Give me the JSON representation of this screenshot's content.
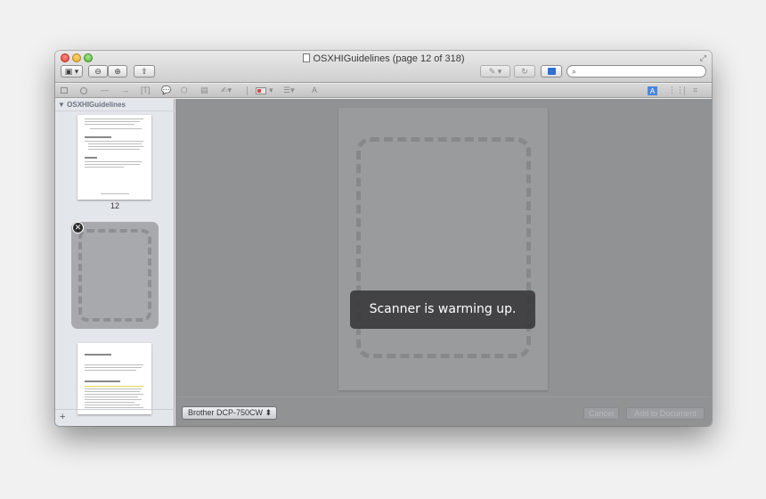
{
  "window": {
    "title": "OSXHIGuidelines (page 12 of 318)"
  },
  "toolbar": {
    "view_icon": "sidebar-toggle-icon",
    "view_glyph": "▣ ▾",
    "zoom_out_glyph": "⊖",
    "zoom_in_glyph": "⊕",
    "share_glyph": "⇪",
    "pen_glyph": "✎ ▾",
    "rotate_glyph": "↻",
    "search_glyph": "⌕",
    "search_value": ""
  },
  "annotations": {
    "line_glyph": "—",
    "arrow_glyph": "→",
    "text_box_glyph": "[T]",
    "speech_glyph": "💬",
    "stamp_glyph": "⬡",
    "note_glyph": "▤",
    "signature_glyph": "✍▾",
    "lines_glyph": "☰▾",
    "font_glyph": "A",
    "selected_glyph": "A",
    "grid_glyph": "⋮⋮",
    "crop_glyph": "⌗"
  },
  "sidebar": {
    "header": "▼ OSXHIGuidelines",
    "page_label": "12",
    "remove_glyph": "✕",
    "add_glyph": "+"
  },
  "main": {
    "hud_message": "Scanner is warming up.",
    "scanner_name": "Brother DCP-750CW ⬍",
    "cancel_label": "Cancel",
    "add_label": "Add to Document"
  },
  "colors": {
    "accent": "#2f6fd6",
    "close": "#e0443a",
    "minimize": "#e8a824",
    "zoom": "#55b53a"
  }
}
